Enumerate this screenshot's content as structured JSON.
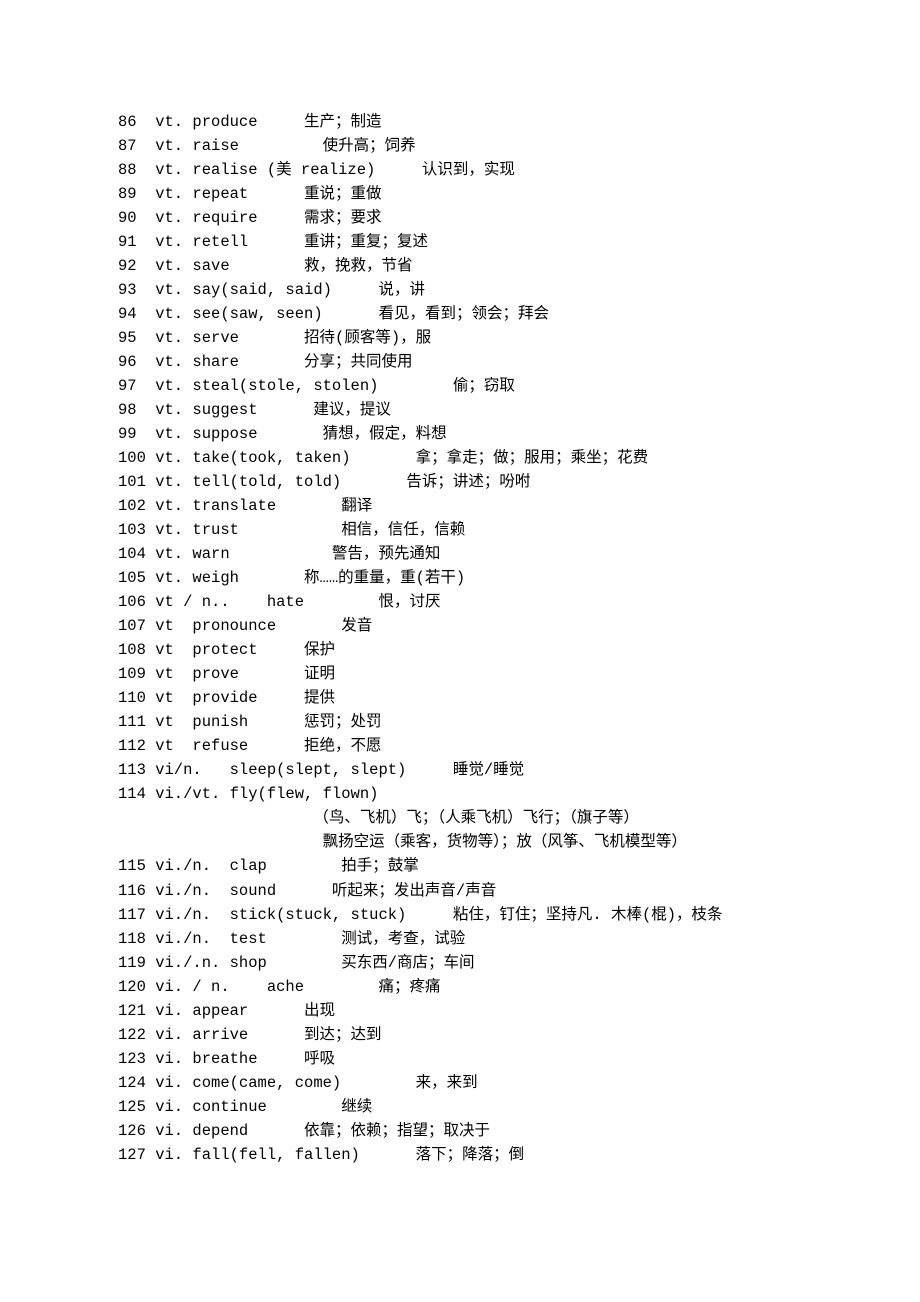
{
  "lines": [
    "86  vt. produce     生产；制造",
    "87  vt. raise         使升高；饲养",
    "88  vt. realise (美 realize)     认识到，实现",
    "89  vt. repeat      重说；重做",
    "90  vt. require     需求；要求",
    "91  vt. retell      重讲；重复；复述",
    "92  vt. save        救，挽救，节省",
    "93  vt. say(said, said)     说，讲",
    "94  vt. see(saw, seen)      看见，看到；领会；拜会",
    "95  vt. serve       招待(顾客等)，服",
    "96  vt. share       分享；共同使用",
    "97  vt. steal(stole, stolen)        偷；窃取",
    "98  vt. suggest      建议，提议",
    "99  vt. suppose       猜想，假定，料想",
    "100 vt. take(took, taken)       拿；拿走；做；服用；乘坐；花费",
    "101 vt. tell(told, told)       告诉；讲述；吩咐",
    "102 vt. translate       翻译",
    "103 vt. trust           相信，信任，信赖",
    "104 vt. warn           警告，预先通知",
    "105 vt. weigh       称……的重量，重(若干)",
    "106 vt / n..    hate        恨，讨厌",
    "107 vt  pronounce       发音",
    "108 vt  protect     保护",
    "109 vt  prove       证明",
    "110 vt  provide     提供",
    "111 vt  punish      惩罚；处罚",
    "112 vt  refuse      拒绝，不愿",
    "113 vi/n.   sleep(slept, slept)     睡觉/睡觉",
    "114 vi./vt. fly(flew, flown)",
    "                     （鸟、飞机）飞；（人乘飞机）飞行；（旗子等）",
    "                      飘扬空运（乘客，货物等）；放（风筝、飞机模型等）",
    "115 vi./n.  clap        拍手；鼓掌",
    "116 vi./n.  sound      听起来；发出声音/声音",
    "117 vi./n.  stick(stuck, stuck)     粘住，钉住；坚持凡. 木棒(棍)，枝条",
    "118 vi./n.  test        测试，考查，试验",
    "119 vi./.n. shop        买东西/商店；车间",
    "120 vi. / n.    ache        痛；疼痛",
    "121 vi. appear      出现",
    "122 vi. arrive      到达；达到",
    "123 vi. breathe     呼吸",
    "124 vi. come(came, come)        来，来到",
    "125 vi. continue        继续",
    "126 vi. depend      依靠；依赖；指望；取决于",
    "127 vi. fall(fell, fallen)      落下；降落；倒"
  ]
}
